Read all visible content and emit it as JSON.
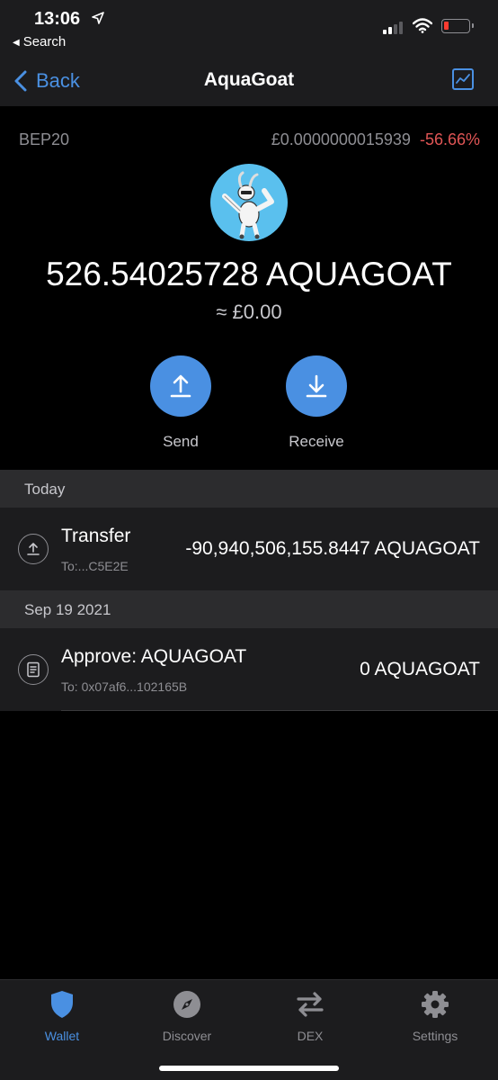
{
  "status_bar": {
    "time": "13:06",
    "back_app": "Search",
    "battery_color": "#ff3b30"
  },
  "nav": {
    "back_label": "Back",
    "title": "AquaGoat",
    "right_icon": "chart-icon"
  },
  "token": {
    "network": "BEP20",
    "price": "£0.0000000015939",
    "change": "-56.66%",
    "change_color": "#e05555",
    "balance": "526.54025728 AQUAGOAT",
    "fiat_value": "≈ £0.00",
    "logo_icon": "goat-logo-icon"
  },
  "actions": {
    "send_label": "Send",
    "receive_label": "Receive",
    "accent": "#4a90e2"
  },
  "sections": [
    {
      "header": "Today",
      "transactions": [
        {
          "icon": "upload-icon",
          "title": "Transfer",
          "subtitle": "To:...C5E2E",
          "amount": "-90,940,506,155.8447 AQUAGOAT"
        }
      ]
    },
    {
      "header": "Sep 19 2021",
      "transactions": [
        {
          "icon": "document-icon",
          "title": "Approve: AQUAGOAT",
          "subtitle": "To: 0x07af6...102165B",
          "amount": "0 AQUAGOAT"
        }
      ]
    }
  ],
  "tabbar": {
    "items": [
      {
        "label": "Wallet",
        "icon": "shield-icon",
        "active": true
      },
      {
        "label": "Discover",
        "icon": "compass-icon",
        "active": false
      },
      {
        "label": "DEX",
        "icon": "swap-icon",
        "active": false
      },
      {
        "label": "Settings",
        "icon": "gear-icon",
        "active": false
      }
    ]
  }
}
